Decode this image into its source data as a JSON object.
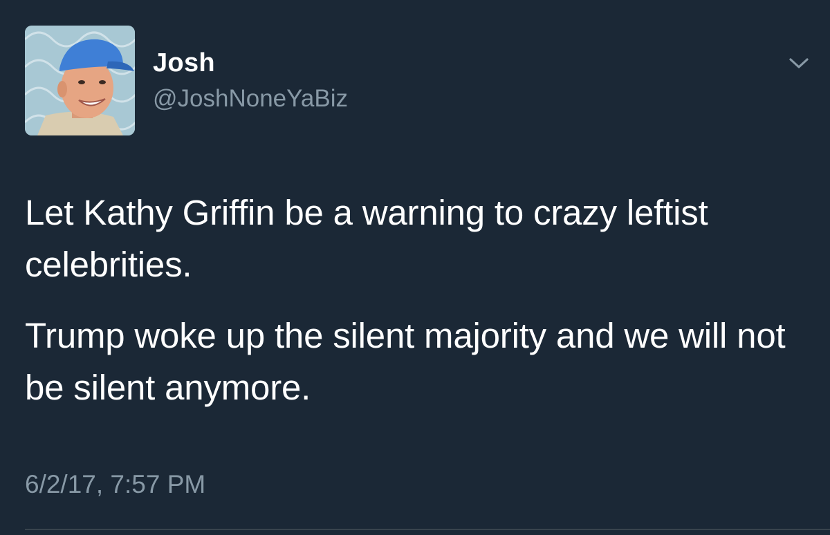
{
  "tweet": {
    "author": {
      "display_name": "Josh",
      "handle": "@JoshNoneYaBiz",
      "avatar_icon": "user-photo-blue-cap"
    },
    "menu_icon": "chevron-down-icon",
    "paragraphs": [
      "Let Kathy Griffin be a warning to crazy leftist celebrities.",
      "Trump woke up the silent majority and we will not be silent anymore."
    ],
    "timestamp": "6/2/17, 7:57 PM"
  },
  "colors": {
    "background": "#1b2836",
    "primary_text": "#ffffff",
    "secondary_text": "#8899a6",
    "divider": "#38444d"
  }
}
